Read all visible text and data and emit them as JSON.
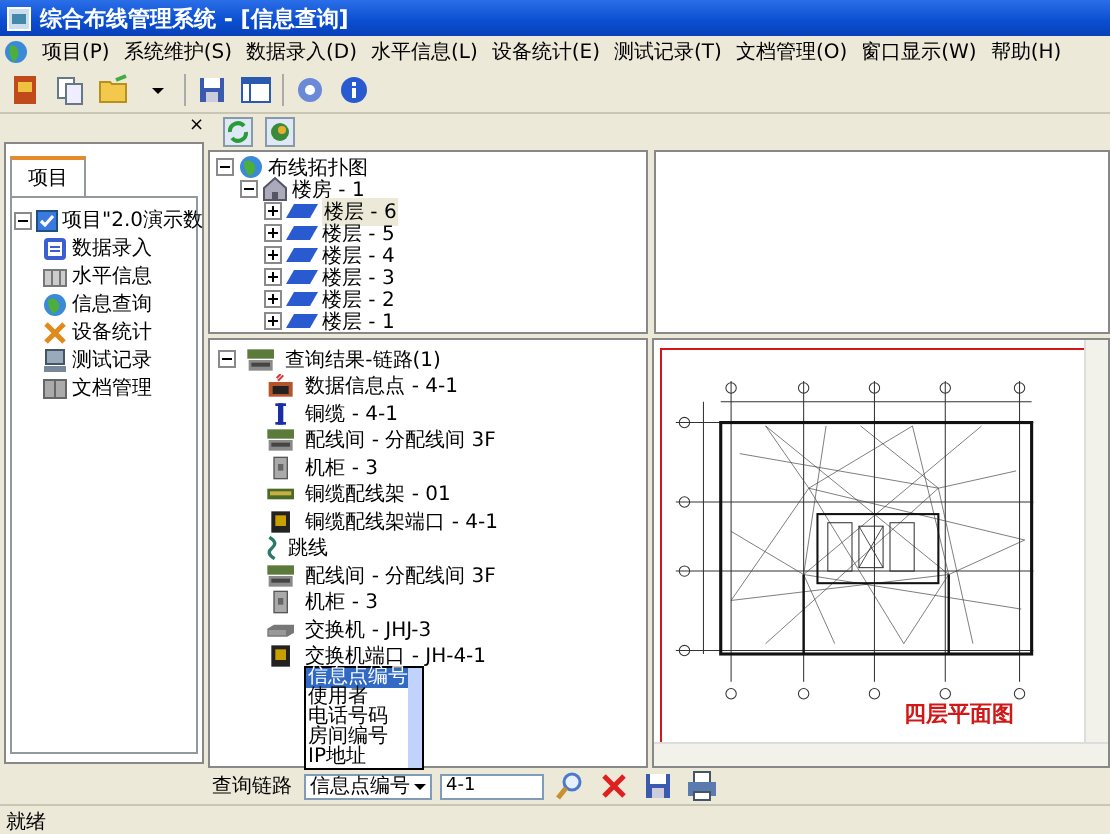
{
  "window": {
    "title": "综合布线管理系统 - [信息查询]"
  },
  "menu": [
    "项目(P)",
    "系统维护(S)",
    "数据录入(D)",
    "水平信息(L)",
    "设备统计(E)",
    "测试记录(T)",
    "文档管理(O)",
    "窗口显示(W)",
    "帮助(H)"
  ],
  "side_panel": {
    "close": "×",
    "tabs": [
      {
        "label": "项目",
        "selected": true
      }
    ],
    "tree": {
      "label": "项目\"2.0演示数",
      "checked": true,
      "expanded": true,
      "children": [
        {
          "label": "数据录入",
          "kind": "entry"
        },
        {
          "label": "水平信息",
          "kind": "horizontal"
        },
        {
          "label": "信息查询",
          "kind": "query"
        },
        {
          "label": "设备统计",
          "kind": "stats"
        },
        {
          "label": "测试记录",
          "kind": "test"
        },
        {
          "label": "文档管理",
          "kind": "docs"
        }
      ]
    }
  },
  "topology": {
    "label": "布线拓扑图",
    "expanded": true,
    "children": [
      {
        "label": "楼房 - 1",
        "expanded": true,
        "children": [
          {
            "label": "楼层 - 6",
            "expanded": false,
            "selected": true
          },
          {
            "label": "楼层 - 5",
            "expanded": false,
            "selected": false
          },
          {
            "label": "楼层 - 4",
            "expanded": false,
            "selected": false
          },
          {
            "label": "楼层 - 3",
            "expanded": false,
            "selected": false
          },
          {
            "label": "楼层 - 2",
            "expanded": false,
            "selected": false
          },
          {
            "label": "楼层 - 1",
            "expanded": false,
            "selected": false
          }
        ]
      }
    ]
  },
  "results": {
    "label": "查询结果-链路(1)",
    "expanded": true,
    "children": [
      {
        "label": "数据信息点 - 4-1",
        "kind": "outlet"
      },
      {
        "label": "铜缆 - 4-1",
        "kind": "cable"
      },
      {
        "label": "配线间 - 分配线间 3F",
        "kind": "room"
      },
      {
        "label": "机柜 - 3",
        "kind": "cabinet"
      },
      {
        "label": "铜缆配线架 - 01",
        "kind": "panel"
      },
      {
        "label": "铜缆配线架端口 - 4-1",
        "kind": "port"
      },
      {
        "label": "跳线",
        "kind": "jumper"
      },
      {
        "label": "配线间 - 分配线间 3F",
        "kind": "room"
      },
      {
        "label": "机柜 - 3",
        "kind": "cabinet"
      },
      {
        "label": "交换机 - JHJ-3",
        "kind": "switch"
      },
      {
        "label": "交换机端口 - JH-4-1",
        "kind": "port"
      }
    ]
  },
  "plan": {
    "title": "四层平面图"
  },
  "search": {
    "label": "查询链路",
    "field": "信息点编号",
    "value": "4-1",
    "options": [
      {
        "label": "信息点编号",
        "selected": true
      },
      {
        "label": "使用者",
        "selected": false
      },
      {
        "label": "电话号码",
        "selected": false
      },
      {
        "label": "房间编号",
        "selected": false
      },
      {
        "label": "IP地址",
        "selected": false
      }
    ]
  },
  "status_bar": "就绪"
}
